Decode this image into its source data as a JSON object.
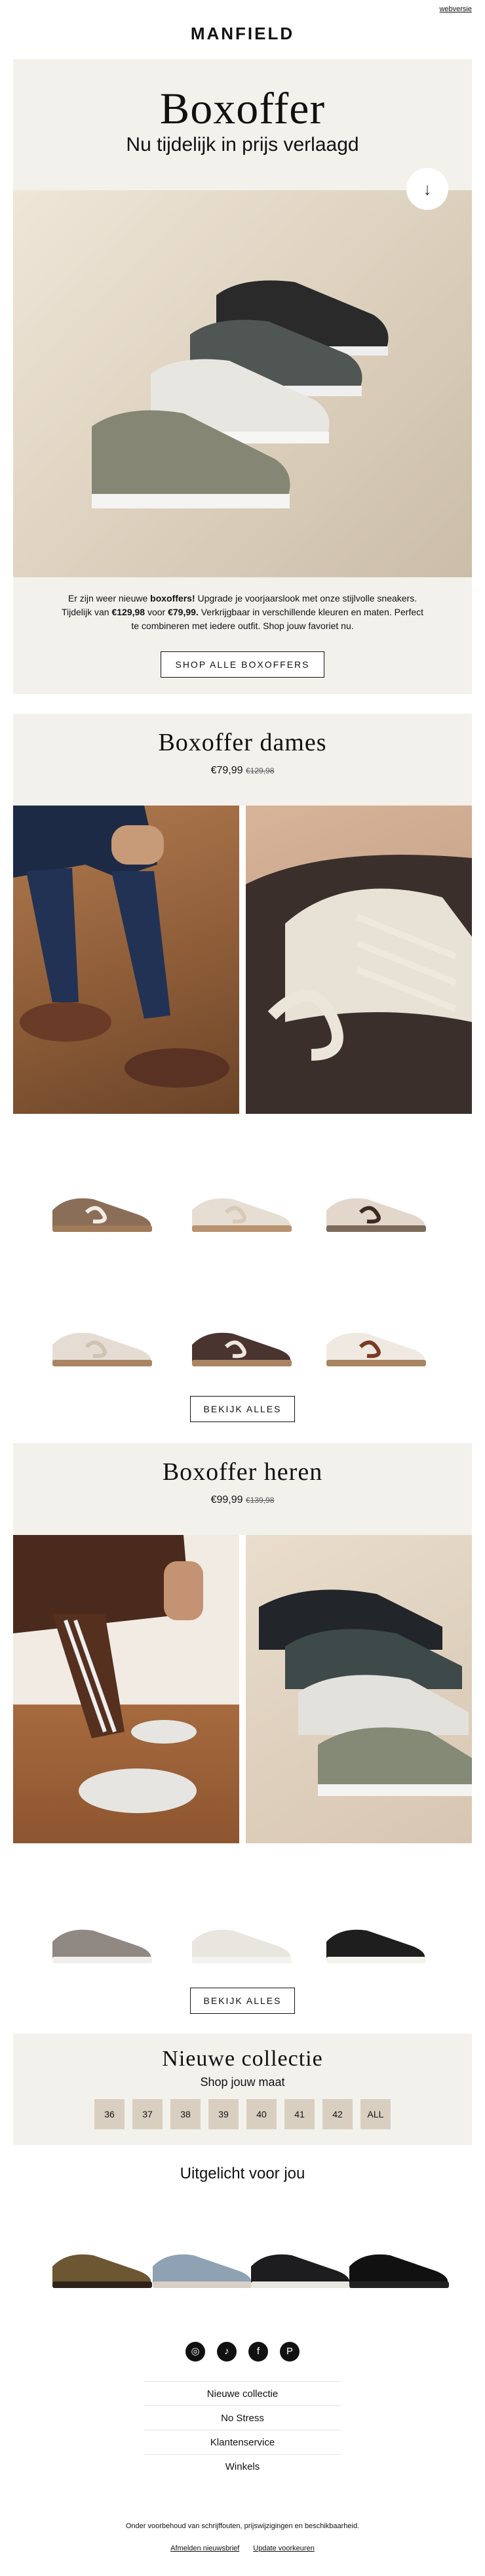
{
  "header": {
    "webversion": "webversie",
    "logo": "MANFIELD"
  },
  "hero": {
    "title": "Boxoffer",
    "subtitle": "Nu tijdelijk in prijs verlaagd",
    "scroll_icon": "arrow-down-icon",
    "intro_parts": [
      "Er zijn weer nieuwe ",
      "boxoffers!",
      " Upgrade je voorjaarslook met onze stijlvolle sneakers. Tijdelijk van ",
      "€129,98",
      " voor ",
      "€79,99.",
      " Verkrijgbaar in verschillende kleuren en maten. Perfect te combineren met iedere outfit. Shop jouw favoriet nu."
    ],
    "cta": "SHOP ALLE BOXOFFERS"
  },
  "dames": {
    "title": "Boxoffer dames",
    "price": "€79,99",
    "old_price": "€129,98",
    "cta": "BEKIJK ALLES"
  },
  "heren": {
    "title": "Boxoffer heren",
    "price": "€99,99",
    "old_price": "€139,98",
    "cta": "BEKIJK ALLES"
  },
  "collectie": {
    "title": "Nieuwe collectie",
    "subtitle": "Shop jouw maat",
    "sizes": [
      "36",
      "37",
      "38",
      "39",
      "40",
      "41",
      "42",
      "ALL"
    ]
  },
  "uitgelicht": {
    "title": "Uitgelicht voor jou"
  },
  "social": [
    "instagram-icon",
    "tiktok-icon",
    "facebook-icon",
    "pinterest-icon"
  ],
  "footer": {
    "links": [
      "Nieuwe collectie",
      "No Stress",
      "Klantenservice",
      "Winkels"
    ],
    "disclaimer": "Onder voorbehoud van schrijffouten, prijswijzigingen en beschikbaarheid.",
    "unsubscribe": "Afmelden nieuwsbrief",
    "preferences": "Update voorkeuren"
  }
}
